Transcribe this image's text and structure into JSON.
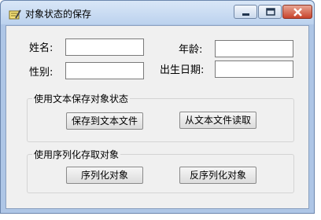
{
  "window": {
    "title": "对象状态的保存",
    "icon": "pencil-note-icon",
    "controls": [
      "minimize-icon",
      "maximize-icon",
      "close-icon"
    ]
  },
  "form": {
    "name_label": "姓名:",
    "name_value": "",
    "age_label": "年龄:",
    "age_value": "",
    "gender_label": "性别:",
    "gender_value": "",
    "birthdate_label": "出生日期:",
    "birthdate_value": ""
  },
  "text_group": {
    "title": "使用文本保存对象状态",
    "save_button": "保存到文本文件",
    "load_button": "从文本文件读取"
  },
  "serialize_group": {
    "title": "使用序列化存取对象",
    "serialize_button": "序列化对象",
    "deserialize_button": "反序列化对象"
  },
  "colors": {
    "frame": "#aec6e6",
    "client": "#f0f0f0",
    "close_button": "#c8442c"
  }
}
